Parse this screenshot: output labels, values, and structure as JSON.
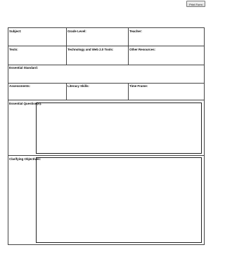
{
  "toolbar": {
    "print_label": "Print Form"
  },
  "form": {
    "subject_label": "Subject:",
    "grade_level_label": "Grade Level:",
    "teacher_label": "Teacher:",
    "texts_label": "Texts:",
    "tech_tools_label": "Technology and Web 2.0 Tools:",
    "other_resources_label": "Other Resources:",
    "essential_standard_label": "Essential Standard:",
    "assessments_label": "Assessments:",
    "literacy_skills_label": "Literacy Skills:",
    "time_frame_label": "Time Frame:",
    "essential_questions_label": "Essential Question(s):",
    "clarifying_objectives_label": "Clarifying Objectives:"
  }
}
